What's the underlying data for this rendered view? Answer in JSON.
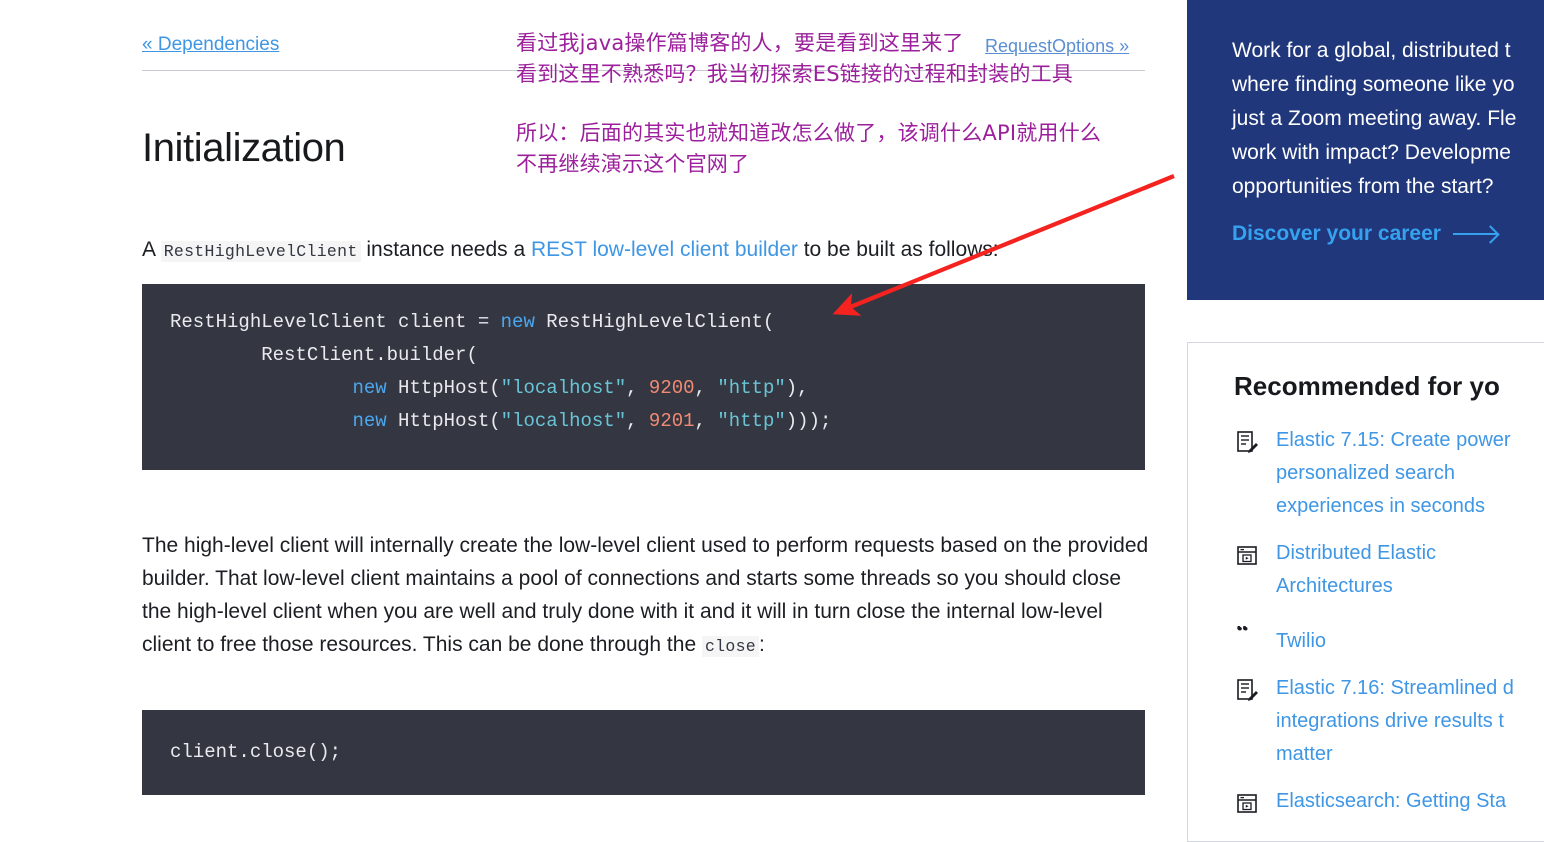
{
  "breadcrumb": {
    "prev_label": "« Dependencies",
    "next_label": "RequestOptions »"
  },
  "page_title": "Initialization",
  "intro": {
    "before_code": "A ",
    "inline_code": "RestHighLevelClient",
    "middle": " instance needs a ",
    "link": "REST low-level client builder",
    "after_link": " to be built as follows:"
  },
  "code_init": {
    "line1_a": "RestHighLevelClient client = ",
    "line1_kw": "new",
    "line1_b": " RestHighLevelClient(",
    "line2": "        RestClient.builder(",
    "line3_indent": "                ",
    "line3_kw": "new",
    "line3_a": " HttpHost(",
    "line3_str1": "\"localhost\"",
    "line3_c1": ", ",
    "line3_num": "9200",
    "line3_c2": ", ",
    "line3_str2": "\"http\"",
    "line3_end": "),",
    "line4_indent": "                ",
    "line4_kw": "new",
    "line4_a": " HttpHost(",
    "line4_str1": "\"localhost\"",
    "line4_c1": ", ",
    "line4_num": "9201",
    "line4_c2": ", ",
    "line4_str2": "\"http\"",
    "line4_end": ")));"
  },
  "body_paragraph": {
    "part1": "The high-level client will internally create the low-level client used to perform requests based on the provided builder. That low-level client maintains a pool of connections and starts some threads so you should close the high-level client when you are well and truly done with it and it will in turn close the internal low-level client to free those resources. This can be done through the ",
    "inline_code": "close",
    "part2": ":"
  },
  "code_close": {
    "line1": "client.close();"
  },
  "career_banner": {
    "body": "Work for a global, distributed t where finding someone like yo just a Zoom meeting away. Fle work with impact? Developme opportunities from the start?",
    "cta": "Discover your career",
    "bg_color": "#20377c",
    "cta_color": "#36a2ef"
  },
  "recommended": {
    "title": "Recommended for yo",
    "items": [
      {
        "icon": "article-edit-icon",
        "label": "Elastic 7.15: Create power personalized search experiences in seconds"
      },
      {
        "icon": "video-window-icon",
        "label": "Distributed Elastic Architectures"
      },
      {
        "icon": "quote-icon",
        "label": "Twilio"
      },
      {
        "icon": "article-edit-icon",
        "label": "Elastic 7.16: Streamlined d integrations drive results t matter"
      },
      {
        "icon": "video-window-icon",
        "label": "Elasticsearch: Getting Sta"
      }
    ]
  },
  "annotations": {
    "color": "#9c1f9c",
    "note1": "看过我java操作篇博客的人，要是看到这里来了\n看到这里不熟悉吗？我当初探索ES链接的过程和封装的工具",
    "note2": "所以：后面的其实也就知道改怎么做了，该调什么API就用什么\n不再继续演示这个官网了",
    "arrow_color": "#f5231f"
  }
}
